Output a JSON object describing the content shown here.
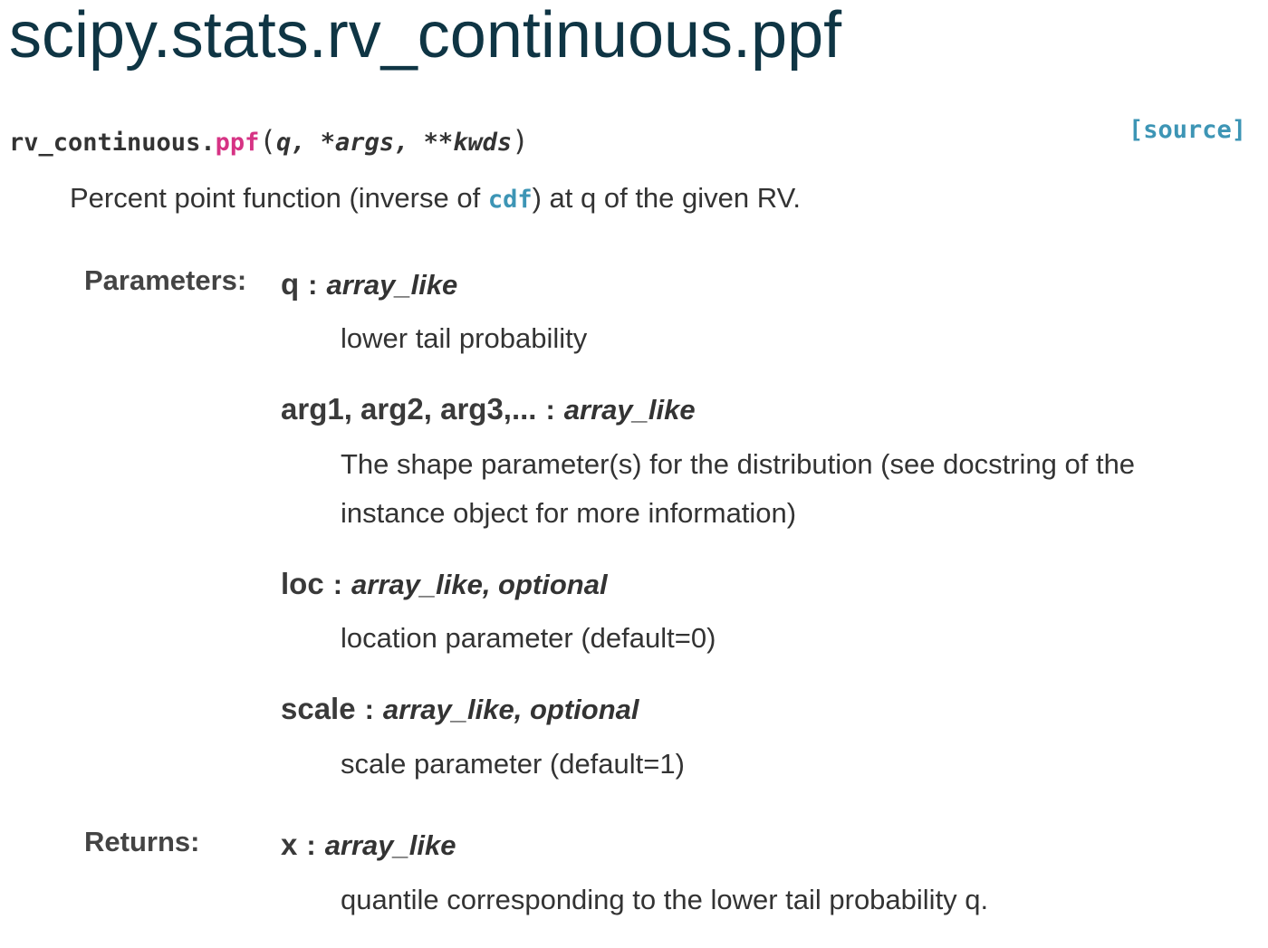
{
  "title": "scipy.stats.rv_continuous.ppf",
  "signature": {
    "class_prefix": "rv_continuous.",
    "method": "ppf",
    "open_paren": "(",
    "params": "q, *args, **kwds",
    "close_paren": ")",
    "source_label": "[source]"
  },
  "summary": {
    "before": "Percent point function (inverse of ",
    "link": "cdf",
    "after": ") at q of the given RV."
  },
  "parameters_label": "Parameters:",
  "parameters": [
    {
      "name": "q",
      "type": "array_like",
      "description": "lower tail probability"
    },
    {
      "name": "arg1, arg2, arg3,...",
      "type": "array_like",
      "description": "The shape parameter(s) for the distribution (see docstring of the instance object for more information)"
    },
    {
      "name": "loc",
      "type": "array_like, optional",
      "description": "location parameter (default=0)"
    },
    {
      "name": "scale",
      "type": "array_like, optional",
      "description": "scale parameter (default=1)"
    }
  ],
  "returns_label": "Returns:",
  "returns": [
    {
      "name": "x",
      "type": "array_like",
      "description": "quantile corresponding to the lower tail probability q."
    }
  ],
  "separator": ":",
  "colors": {
    "title": "#0f3544",
    "method_name": "#d63384",
    "link": "#3d95b5",
    "text": "#333333"
  }
}
